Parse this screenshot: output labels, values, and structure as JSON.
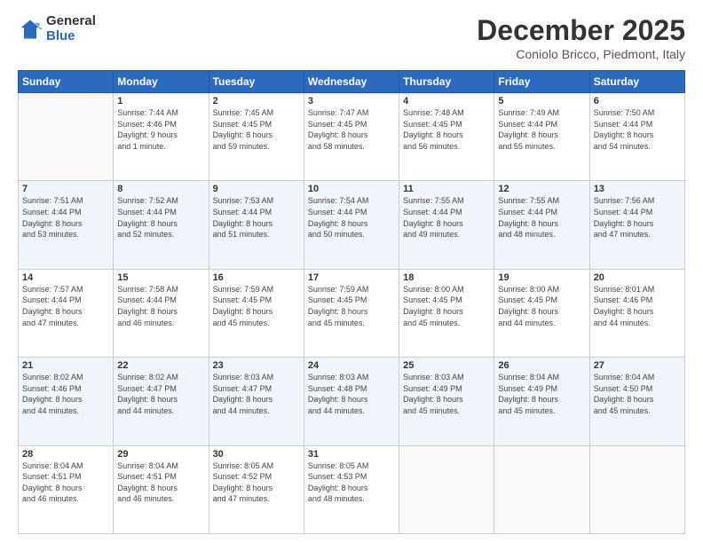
{
  "logo": {
    "general": "General",
    "blue": "Blue"
  },
  "header": {
    "month": "December 2025",
    "location": "Coniolo Bricco, Piedmont, Italy"
  },
  "days_of_week": [
    "Sunday",
    "Monday",
    "Tuesday",
    "Wednesday",
    "Thursday",
    "Friday",
    "Saturday"
  ],
  "weeks": [
    [
      {
        "day": "",
        "info": ""
      },
      {
        "day": "1",
        "info": "Sunrise: 7:44 AM\nSunset: 4:46 PM\nDaylight: 9 hours\nand 1 minute."
      },
      {
        "day": "2",
        "info": "Sunrise: 7:45 AM\nSunset: 4:45 PM\nDaylight: 8 hours\nand 59 minutes."
      },
      {
        "day": "3",
        "info": "Sunrise: 7:47 AM\nSunset: 4:45 PM\nDaylight: 8 hours\nand 58 minutes."
      },
      {
        "day": "4",
        "info": "Sunrise: 7:48 AM\nSunset: 4:45 PM\nDaylight: 8 hours\nand 56 minutes."
      },
      {
        "day": "5",
        "info": "Sunrise: 7:49 AM\nSunset: 4:44 PM\nDaylight: 8 hours\nand 55 minutes."
      },
      {
        "day": "6",
        "info": "Sunrise: 7:50 AM\nSunset: 4:44 PM\nDaylight: 8 hours\nand 54 minutes."
      }
    ],
    [
      {
        "day": "7",
        "info": "Sunrise: 7:51 AM\nSunset: 4:44 PM\nDaylight: 8 hours\nand 53 minutes."
      },
      {
        "day": "8",
        "info": "Sunrise: 7:52 AM\nSunset: 4:44 PM\nDaylight: 8 hours\nand 52 minutes."
      },
      {
        "day": "9",
        "info": "Sunrise: 7:53 AM\nSunset: 4:44 PM\nDaylight: 8 hours\nand 51 minutes."
      },
      {
        "day": "10",
        "info": "Sunrise: 7:54 AM\nSunset: 4:44 PM\nDaylight: 8 hours\nand 50 minutes."
      },
      {
        "day": "11",
        "info": "Sunrise: 7:55 AM\nSunset: 4:44 PM\nDaylight: 8 hours\nand 49 minutes."
      },
      {
        "day": "12",
        "info": "Sunrise: 7:55 AM\nSunset: 4:44 PM\nDaylight: 8 hours\nand 48 minutes."
      },
      {
        "day": "13",
        "info": "Sunrise: 7:56 AM\nSunset: 4:44 PM\nDaylight: 8 hours\nand 47 minutes."
      }
    ],
    [
      {
        "day": "14",
        "info": "Sunrise: 7:57 AM\nSunset: 4:44 PM\nDaylight: 8 hours\nand 47 minutes."
      },
      {
        "day": "15",
        "info": "Sunrise: 7:58 AM\nSunset: 4:44 PM\nDaylight: 8 hours\nand 46 minutes."
      },
      {
        "day": "16",
        "info": "Sunrise: 7:59 AM\nSunset: 4:45 PM\nDaylight: 8 hours\nand 45 minutes."
      },
      {
        "day": "17",
        "info": "Sunrise: 7:59 AM\nSunset: 4:45 PM\nDaylight: 8 hours\nand 45 minutes."
      },
      {
        "day": "18",
        "info": "Sunrise: 8:00 AM\nSunset: 4:45 PM\nDaylight: 8 hours\nand 45 minutes."
      },
      {
        "day": "19",
        "info": "Sunrise: 8:00 AM\nSunset: 4:45 PM\nDaylight: 8 hours\nand 44 minutes."
      },
      {
        "day": "20",
        "info": "Sunrise: 8:01 AM\nSunset: 4:46 PM\nDaylight: 8 hours\nand 44 minutes."
      }
    ],
    [
      {
        "day": "21",
        "info": "Sunrise: 8:02 AM\nSunset: 4:46 PM\nDaylight: 8 hours\nand 44 minutes."
      },
      {
        "day": "22",
        "info": "Sunrise: 8:02 AM\nSunset: 4:47 PM\nDaylight: 8 hours\nand 44 minutes."
      },
      {
        "day": "23",
        "info": "Sunrise: 8:03 AM\nSunset: 4:47 PM\nDaylight: 8 hours\nand 44 minutes."
      },
      {
        "day": "24",
        "info": "Sunrise: 8:03 AM\nSunset: 4:48 PM\nDaylight: 8 hours\nand 44 minutes."
      },
      {
        "day": "25",
        "info": "Sunrise: 8:03 AM\nSunset: 4:49 PM\nDaylight: 8 hours\nand 45 minutes."
      },
      {
        "day": "26",
        "info": "Sunrise: 8:04 AM\nSunset: 4:49 PM\nDaylight: 8 hours\nand 45 minutes."
      },
      {
        "day": "27",
        "info": "Sunrise: 8:04 AM\nSunset: 4:50 PM\nDaylight: 8 hours\nand 45 minutes."
      }
    ],
    [
      {
        "day": "28",
        "info": "Sunrise: 8:04 AM\nSunset: 4:51 PM\nDaylight: 8 hours\nand 46 minutes."
      },
      {
        "day": "29",
        "info": "Sunrise: 8:04 AM\nSunset: 4:51 PM\nDaylight: 8 hours\nand 46 minutes."
      },
      {
        "day": "30",
        "info": "Sunrise: 8:05 AM\nSunset: 4:52 PM\nDaylight: 8 hours\nand 47 minutes."
      },
      {
        "day": "31",
        "info": "Sunrise: 8:05 AM\nSunset: 4:53 PM\nDaylight: 8 hours\nand 48 minutes."
      },
      {
        "day": "",
        "info": ""
      },
      {
        "day": "",
        "info": ""
      },
      {
        "day": "",
        "info": ""
      }
    ]
  ]
}
